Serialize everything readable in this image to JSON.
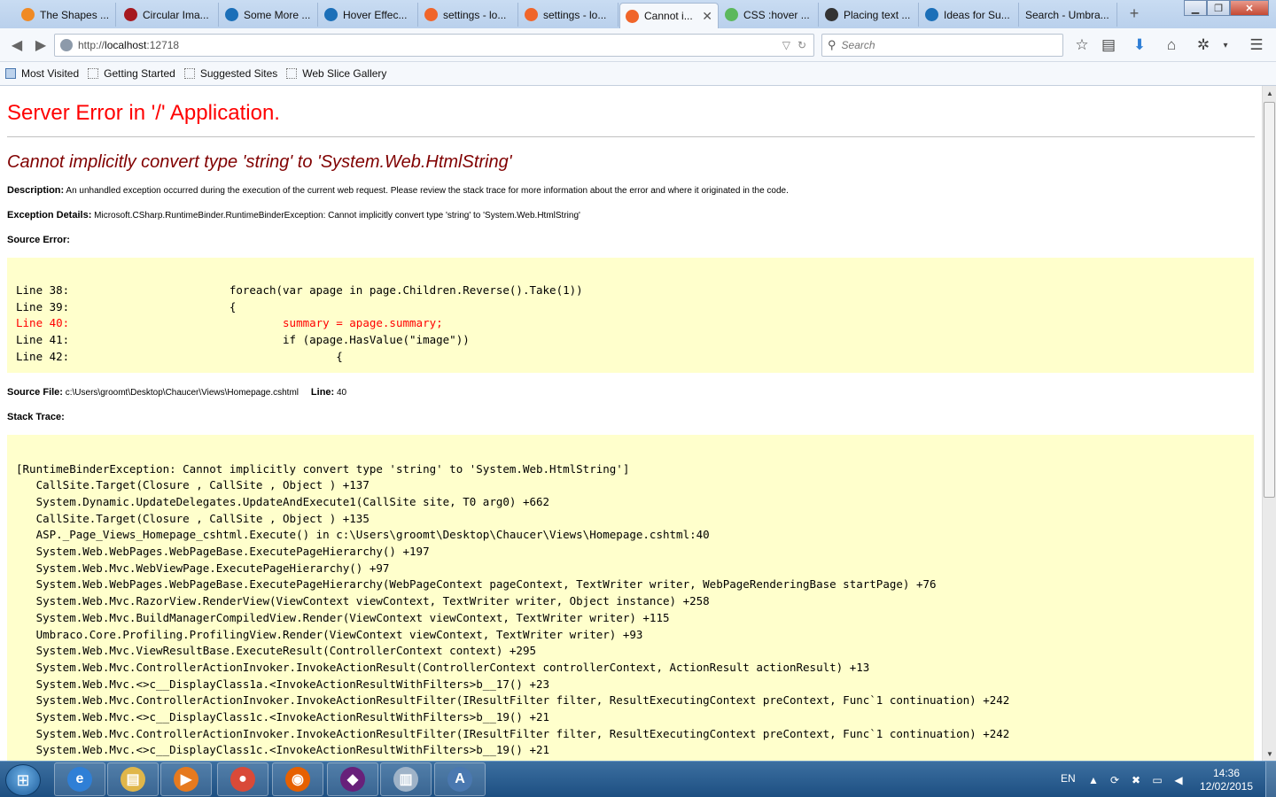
{
  "browser": {
    "tabs": [
      {
        "label": "The Shapes ...",
        "icon": "css-tricks-icon",
        "icon_color": "#f08a24",
        "active": false
      },
      {
        "label": "Circular Ima...",
        "icon": "bootstrap-icon",
        "icon_color": "#a6191f",
        "active": false
      },
      {
        "label": "Some More ...",
        "icon": "umbraco-icon",
        "icon_color": "#1b6fb8",
        "active": false
      },
      {
        "label": "Hover Effec...",
        "icon": "drop-icon",
        "icon_color": "#1b6fb8",
        "active": false
      },
      {
        "label": "settings - lo...",
        "icon": "umbraco-icon",
        "icon_color": "#f0652a",
        "active": false
      },
      {
        "label": "settings - lo...",
        "icon": "umbraco-icon",
        "icon_color": "#f0652a",
        "active": false
      },
      {
        "label": "Cannot i...",
        "icon": "umbraco-icon",
        "icon_color": "#f0652a",
        "active": true
      },
      {
        "label": "CSS :hover ...",
        "icon": "w3schools-icon",
        "icon_color": "#5cb85c",
        "active": false
      },
      {
        "label": "Placing text ...",
        "icon": "linux-icon",
        "icon_color": "#333333",
        "active": false
      },
      {
        "label": "Ideas for Su...",
        "icon": "umbraco-icon",
        "icon_color": "#1b6fb8",
        "active": false
      },
      {
        "label": "Search - Umbra...",
        "icon": "",
        "icon_color": "",
        "active": false
      }
    ],
    "tab_close_glyph": "✕",
    "new_tab_glyph": "+",
    "url_prefix": "http://",
    "url_host": "localhost",
    "url_port": ":12718",
    "search_placeholder": "Search",
    "bookmarks": [
      {
        "label": "Most Visited",
        "icon": "most-visited-icon"
      },
      {
        "label": "Getting Started",
        "icon": "bookmark-page-icon"
      },
      {
        "label": "Suggested Sites",
        "icon": "bookmark-page-icon"
      },
      {
        "label": "Web Slice Gallery",
        "icon": "bookmark-page-icon"
      }
    ]
  },
  "page": {
    "title": "Server Error in '/' Application.",
    "error_heading": "Cannot implicitly convert type 'string' to 'System.Web.HtmlString'",
    "description_label": "Description:",
    "description_text": "An unhandled exception occurred during the execution of the current web request. Please review the stack trace for more information about the error and where it originated in the code.",
    "exception_label": "Exception Details:",
    "exception_text": "Microsoft.CSharp.RuntimeBinder.RuntimeBinderException: Cannot implicitly convert type 'string' to 'System.Web.HtmlString'",
    "source_error_label": "Source Error:",
    "source_lines": [
      {
        "text": "Line 38:                        foreach(var apage in page.Children.Reverse().Take(1))",
        "highlight": false
      },
      {
        "text": "Line 39:                        {",
        "highlight": false
      },
      {
        "text": "Line 40:                                summary = apage.summary;",
        "highlight": true
      },
      {
        "text": "Line 41:                                if (apage.HasValue(\"image\"))",
        "highlight": false
      },
      {
        "text": "Line 42:                                        {",
        "highlight": false
      }
    ],
    "source_file_label": "Source File:",
    "source_file_path": "c:\\Users\\groomt\\Desktop\\Chaucer\\Views\\Homepage.cshtml",
    "line_label": "Line:",
    "line_number": "40",
    "stack_trace_label": "Stack Trace:",
    "stack_trace": [
      "[RuntimeBinderException: Cannot implicitly convert type 'string' to 'System.Web.HtmlString']",
      "   CallSite.Target(Closure , CallSite , Object ) +137",
      "   System.Dynamic.UpdateDelegates.UpdateAndExecute1(CallSite site, T0 arg0) +662",
      "   CallSite.Target(Closure , CallSite , Object ) +135",
      "   ASP._Page_Views_Homepage_cshtml.Execute() in c:\\Users\\groomt\\Desktop\\Chaucer\\Views\\Homepage.cshtml:40",
      "   System.Web.WebPages.WebPageBase.ExecutePageHierarchy() +197",
      "   System.Web.Mvc.WebViewPage.ExecutePageHierarchy() +97",
      "   System.Web.WebPages.WebPageBase.ExecutePageHierarchy(WebPageContext pageContext, TextWriter writer, WebPageRenderingBase startPage) +76",
      "   System.Web.Mvc.RazorView.RenderView(ViewContext viewContext, TextWriter writer, Object instance) +258",
      "   System.Web.Mvc.BuildManagerCompiledView.Render(ViewContext viewContext, TextWriter writer) +115",
      "   Umbraco.Core.Profiling.ProfilingView.Render(ViewContext viewContext, TextWriter writer) +93",
      "   System.Web.Mvc.ViewResultBase.ExecuteResult(ControllerContext context) +295",
      "   System.Web.Mvc.ControllerActionInvoker.InvokeActionResult(ControllerContext controllerContext, ActionResult actionResult) +13",
      "   System.Web.Mvc.<>c__DisplayClass1a.<InvokeActionResultWithFilters>b__17() +23",
      "   System.Web.Mvc.ControllerActionInvoker.InvokeActionResultFilter(IResultFilter filter, ResultExecutingContext preContext, Func`1 continuation) +242",
      "   System.Web.Mvc.<>c__DisplayClass1c.<InvokeActionResultWithFilters>b__19() +21",
      "   System.Web.Mvc.ControllerActionInvoker.InvokeActionResultFilter(IResultFilter filter, ResultExecutingContext preContext, Func`1 continuation) +242",
      "   System.Web.Mvc.<>c__DisplayClass1c.<InvokeActionResultWithFilters>b__19() +21"
    ],
    "colors": {
      "title": "#ff0000",
      "heading": "#800000",
      "code_background": "#ffffcc",
      "highlight": "#ff0000"
    }
  },
  "taskbar": {
    "apps": [
      {
        "name": "internet-explorer-icon",
        "glyph": "e",
        "color": "#2f7fd6"
      },
      {
        "name": "file-explorer-icon",
        "glyph": "▤",
        "color": "#e0b64a"
      },
      {
        "name": "media-player-icon",
        "glyph": "▶",
        "color": "#e67a1f"
      },
      {
        "name": "chrome-icon",
        "glyph": "●",
        "color": "#d94a38"
      },
      {
        "name": "firefox-icon",
        "glyph": "◉",
        "color": "#e66000"
      },
      {
        "name": "visual-studio-icon",
        "glyph": "◆",
        "color": "#68217a"
      },
      {
        "name": "server-icon",
        "glyph": "▥",
        "color": "#9fb3c8"
      },
      {
        "name": "word-document-icon",
        "glyph": "A",
        "color": "#4a78b0"
      }
    ],
    "language": "EN",
    "time": "14:36",
    "date": "12/02/2015"
  }
}
